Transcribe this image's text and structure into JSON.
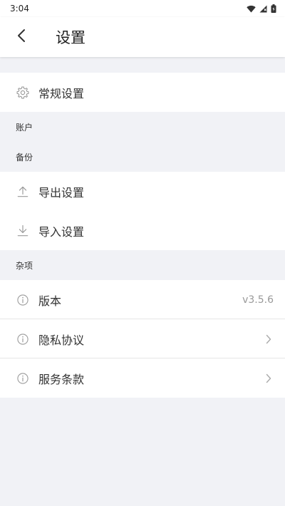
{
  "status": {
    "time": "3:04"
  },
  "header": {
    "title": "设置"
  },
  "general": {
    "label": "常规设置",
    "icon": "gear-icon"
  },
  "sections": {
    "account": "账户",
    "backup": "备份",
    "misc": "杂项"
  },
  "backup": {
    "export_label": "导出设置",
    "import_label": "导入设置"
  },
  "misc": {
    "version_label": "版本",
    "version_value": "v3.5.6",
    "privacy_label": "隐私协议",
    "terms_label": "服务条款"
  },
  "colors": {
    "background": "#f1f2f6",
    "surface": "#ffffff",
    "icon": "#9a9a9a"
  }
}
